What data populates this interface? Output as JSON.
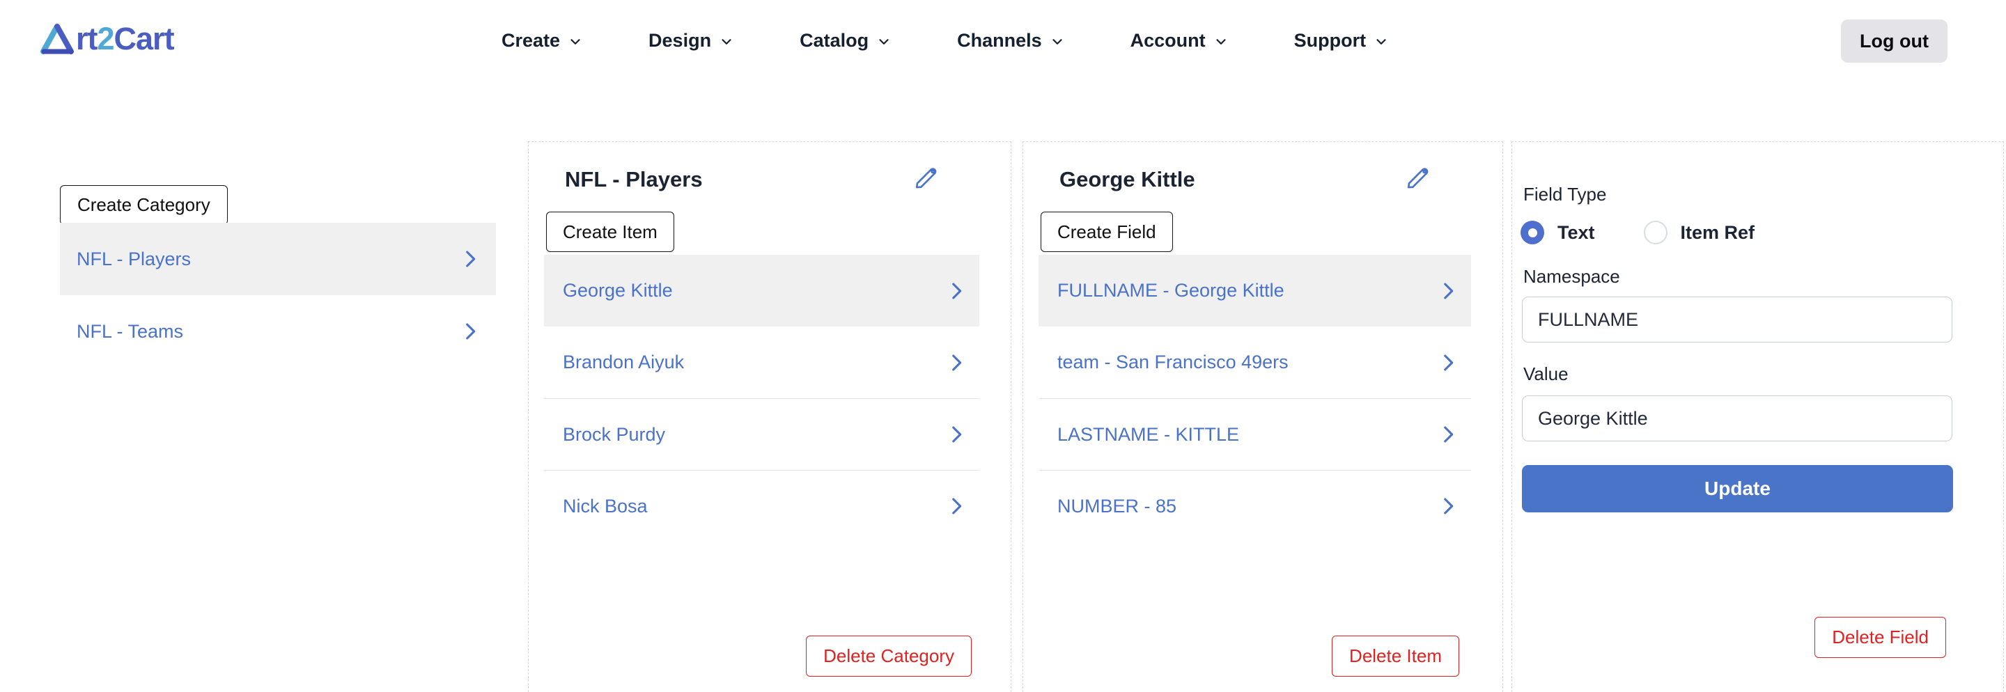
{
  "brand": {
    "part1": "rt",
    "part2": "2",
    "part3": "Cart",
    "full_name": "Art2Cart"
  },
  "nav": {
    "items": [
      {
        "label": "Create"
      },
      {
        "label": "Design"
      },
      {
        "label": "Catalog"
      },
      {
        "label": "Channels"
      },
      {
        "label": "Account"
      },
      {
        "label": "Support"
      }
    ],
    "logout_label": "Log out"
  },
  "sidebar": {
    "create_button": "Create Category",
    "categories": [
      {
        "label": "NFL - Players",
        "selected": true
      },
      {
        "label": "NFL - Teams",
        "selected": false
      }
    ]
  },
  "category_panel": {
    "title": "NFL - Players",
    "create_button": "Create Item",
    "items": [
      {
        "label": "George Kittle",
        "selected": true
      },
      {
        "label": "Brandon Aiyuk",
        "selected": false
      },
      {
        "label": "Brock Purdy",
        "selected": false
      },
      {
        "label": "Nick Bosa",
        "selected": false
      }
    ],
    "delete_button": "Delete Category"
  },
  "item_panel": {
    "title": "George Kittle",
    "create_button": "Create Field",
    "fields": [
      {
        "label": "FULLNAME - George Kittle",
        "selected": true
      },
      {
        "label": "team - San Francisco 49ers",
        "selected": false
      },
      {
        "label": "LASTNAME - KITTLE",
        "selected": false
      },
      {
        "label": "NUMBER - 85",
        "selected": false
      }
    ],
    "delete_button": "Delete Item"
  },
  "field_form": {
    "field_type_label": "Field Type",
    "radios": [
      {
        "label": "Text",
        "selected": true
      },
      {
        "label": "Item Ref",
        "selected": false
      }
    ],
    "namespace_label": "Namespace",
    "namespace_value": "FULLNAME",
    "value_label": "Value",
    "value_value": "George Kittle",
    "update_button": "Update",
    "delete_button": "Delete Field"
  },
  "icons": {
    "brand_mark": "penrose-triangle-logo",
    "nav_caret": "chevron-down",
    "row_caret": "chevron-right",
    "edit": "pencil"
  },
  "colors": {
    "accent_blue": "#4a72c8",
    "radio_blue": "#4e6fce",
    "danger_red": "#e02222",
    "navy_text": "#1c2433",
    "row_highlight": "#f0f0f1",
    "logo_dark": "#4a5ec2",
    "logo_light": "#4fa8d5",
    "logout_gray": "#e3e3e8"
  }
}
